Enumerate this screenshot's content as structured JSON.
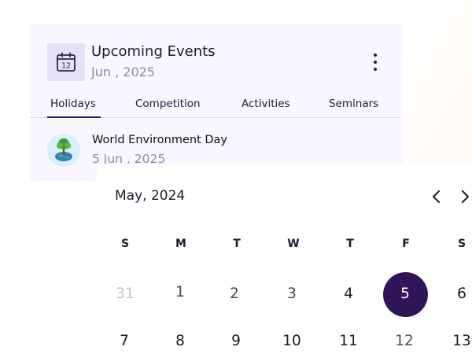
{
  "events_card": {
    "title": "Upcoming Events",
    "subtitle": "Jun , 2025",
    "calendar_icon_day": "12",
    "tabs": [
      {
        "label": "Holidays",
        "active": true
      },
      {
        "label": "Competition",
        "active": false
      },
      {
        "label": "Activities",
        "active": false
      },
      {
        "label": "Seminars",
        "active": false
      }
    ],
    "events": [
      {
        "name": "World Environment Day",
        "date": "5 Jun , 2025",
        "icon": "tree-globe-icon"
      }
    ]
  },
  "calendar": {
    "month_label": "May, 2024",
    "weekdays": [
      "S",
      "M",
      "T",
      "W",
      "T",
      "F",
      "S"
    ],
    "rows": [
      [
        "31",
        "1",
        "2",
        "3",
        "4",
        "5",
        "6"
      ],
      [
        "7",
        "8",
        "9",
        "10",
        "11",
        "12",
        "13"
      ]
    ],
    "selected_day": "5",
    "accent_color": "#2e1659"
  }
}
